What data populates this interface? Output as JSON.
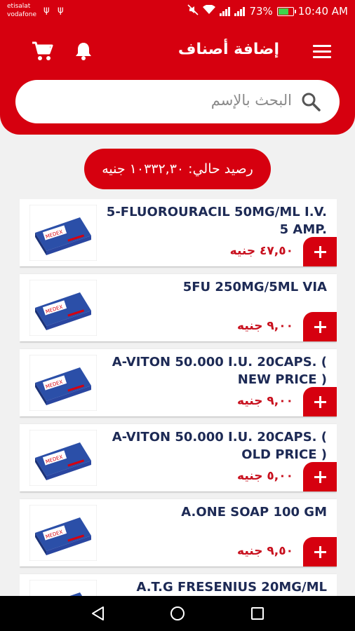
{
  "status_bar": {
    "carrier_1": "etisalat",
    "carrier_2": "vodafone",
    "battery_percent": "73%",
    "time": "10:40 AM",
    "icons": [
      "usb-icon",
      "usb-icon",
      "mute-icon",
      "wifi-icon",
      "signal-icon",
      "signal-icon",
      "battery-charging-icon"
    ]
  },
  "app_bar": {
    "title": "إضافة أصناف",
    "icons": [
      "menu-icon",
      "notification-bell-icon",
      "shopping-cart-icon"
    ]
  },
  "search": {
    "placeholder": "البحث بالإسم",
    "icon": "search-icon"
  },
  "balance": {
    "label": "رصيد حالي: ١٠٣٣٢,٣٠ جنيه"
  },
  "products": [
    {
      "name": "5-FLUOROURACIL 50MG/ML I.V. 5 AMP.",
      "price": "٤٧,٥٠ جنيه"
    },
    {
      "name": "5FU 250MG/5ML VIA",
      "price": "٩,٠٠ جنيه"
    },
    {
      "name": "A-VITON 50.000 I.U. 20CAPS. ( NEW PRICE )",
      "price": "٩,٠٠ جنيه"
    },
    {
      "name": "A-VITON 50.000 I.U. 20CAPS. ( OLD PRICE )",
      "price": "٥,٠٠ جنيه"
    },
    {
      "name": "A.ONE SOAP 100 GM",
      "price": "٩,٥٠ جنيه"
    },
    {
      "name": "A.T.G FRESENIUS 20MG/ML",
      "price": ""
    }
  ],
  "product_image": {
    "brand_text": "MEDEX",
    "icon": "medicine-box-image"
  },
  "nav_bar": {
    "icons": [
      "back-icon",
      "home-icon",
      "recent-apps-icon"
    ]
  },
  "colors": {
    "brand_red": "#d6000f",
    "price_red": "#c8101e",
    "product_name": "#1d2a55",
    "background": "#f1f1f1"
  }
}
